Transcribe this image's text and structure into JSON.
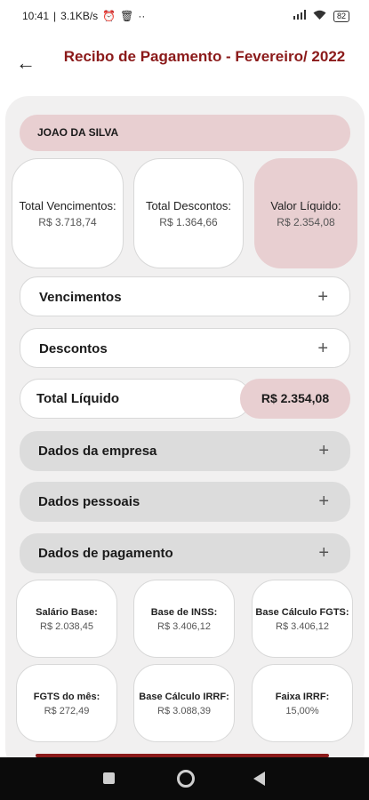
{
  "status": {
    "time": "10:41",
    "speed": "3.1KB/s",
    "battery": "82"
  },
  "header": {
    "title": "Recibo de Pagamento - Fevereiro/ 2022"
  },
  "employee": {
    "name": "JOAO DA SILVA"
  },
  "summary": [
    {
      "label": "Total Vencimentos:",
      "value": "R$ 3.718,74"
    },
    {
      "label": "Total Descontos:",
      "value": "R$ 1.364,66"
    },
    {
      "label": "Valor Líquido:",
      "value": "R$ 2.354,08"
    }
  ],
  "sections": {
    "vencimentos": "Vencimentos",
    "descontos": "Descontos",
    "total_liquido_label": "Total Líquido",
    "total_liquido_value": "R$ 2.354,08",
    "dados_empresa": "Dados da empresa",
    "dados_pessoais": "Dados pessoais",
    "dados_pagamento": "Dados de pagamento",
    "expand_symbol": "+"
  },
  "details": [
    {
      "label": "Salário Base:",
      "value": "R$ 2.038,45"
    },
    {
      "label": "Base de INSS:",
      "value": "R$ 3.406,12"
    },
    {
      "label": "Base Cálculo FGTS:",
      "value": "R$ 3.406,12"
    },
    {
      "label": "FGTS do mês:",
      "value": "R$ 272,49"
    },
    {
      "label": "Base Cálculo IRRF:",
      "value": "R$ 3.088,39"
    },
    {
      "label": "Faixa IRRF:",
      "value": "15,00%"
    }
  ],
  "colors": {
    "accent": "#8b1a1a",
    "pink": "#e8cfd1",
    "panel": "#f1f0f0"
  }
}
